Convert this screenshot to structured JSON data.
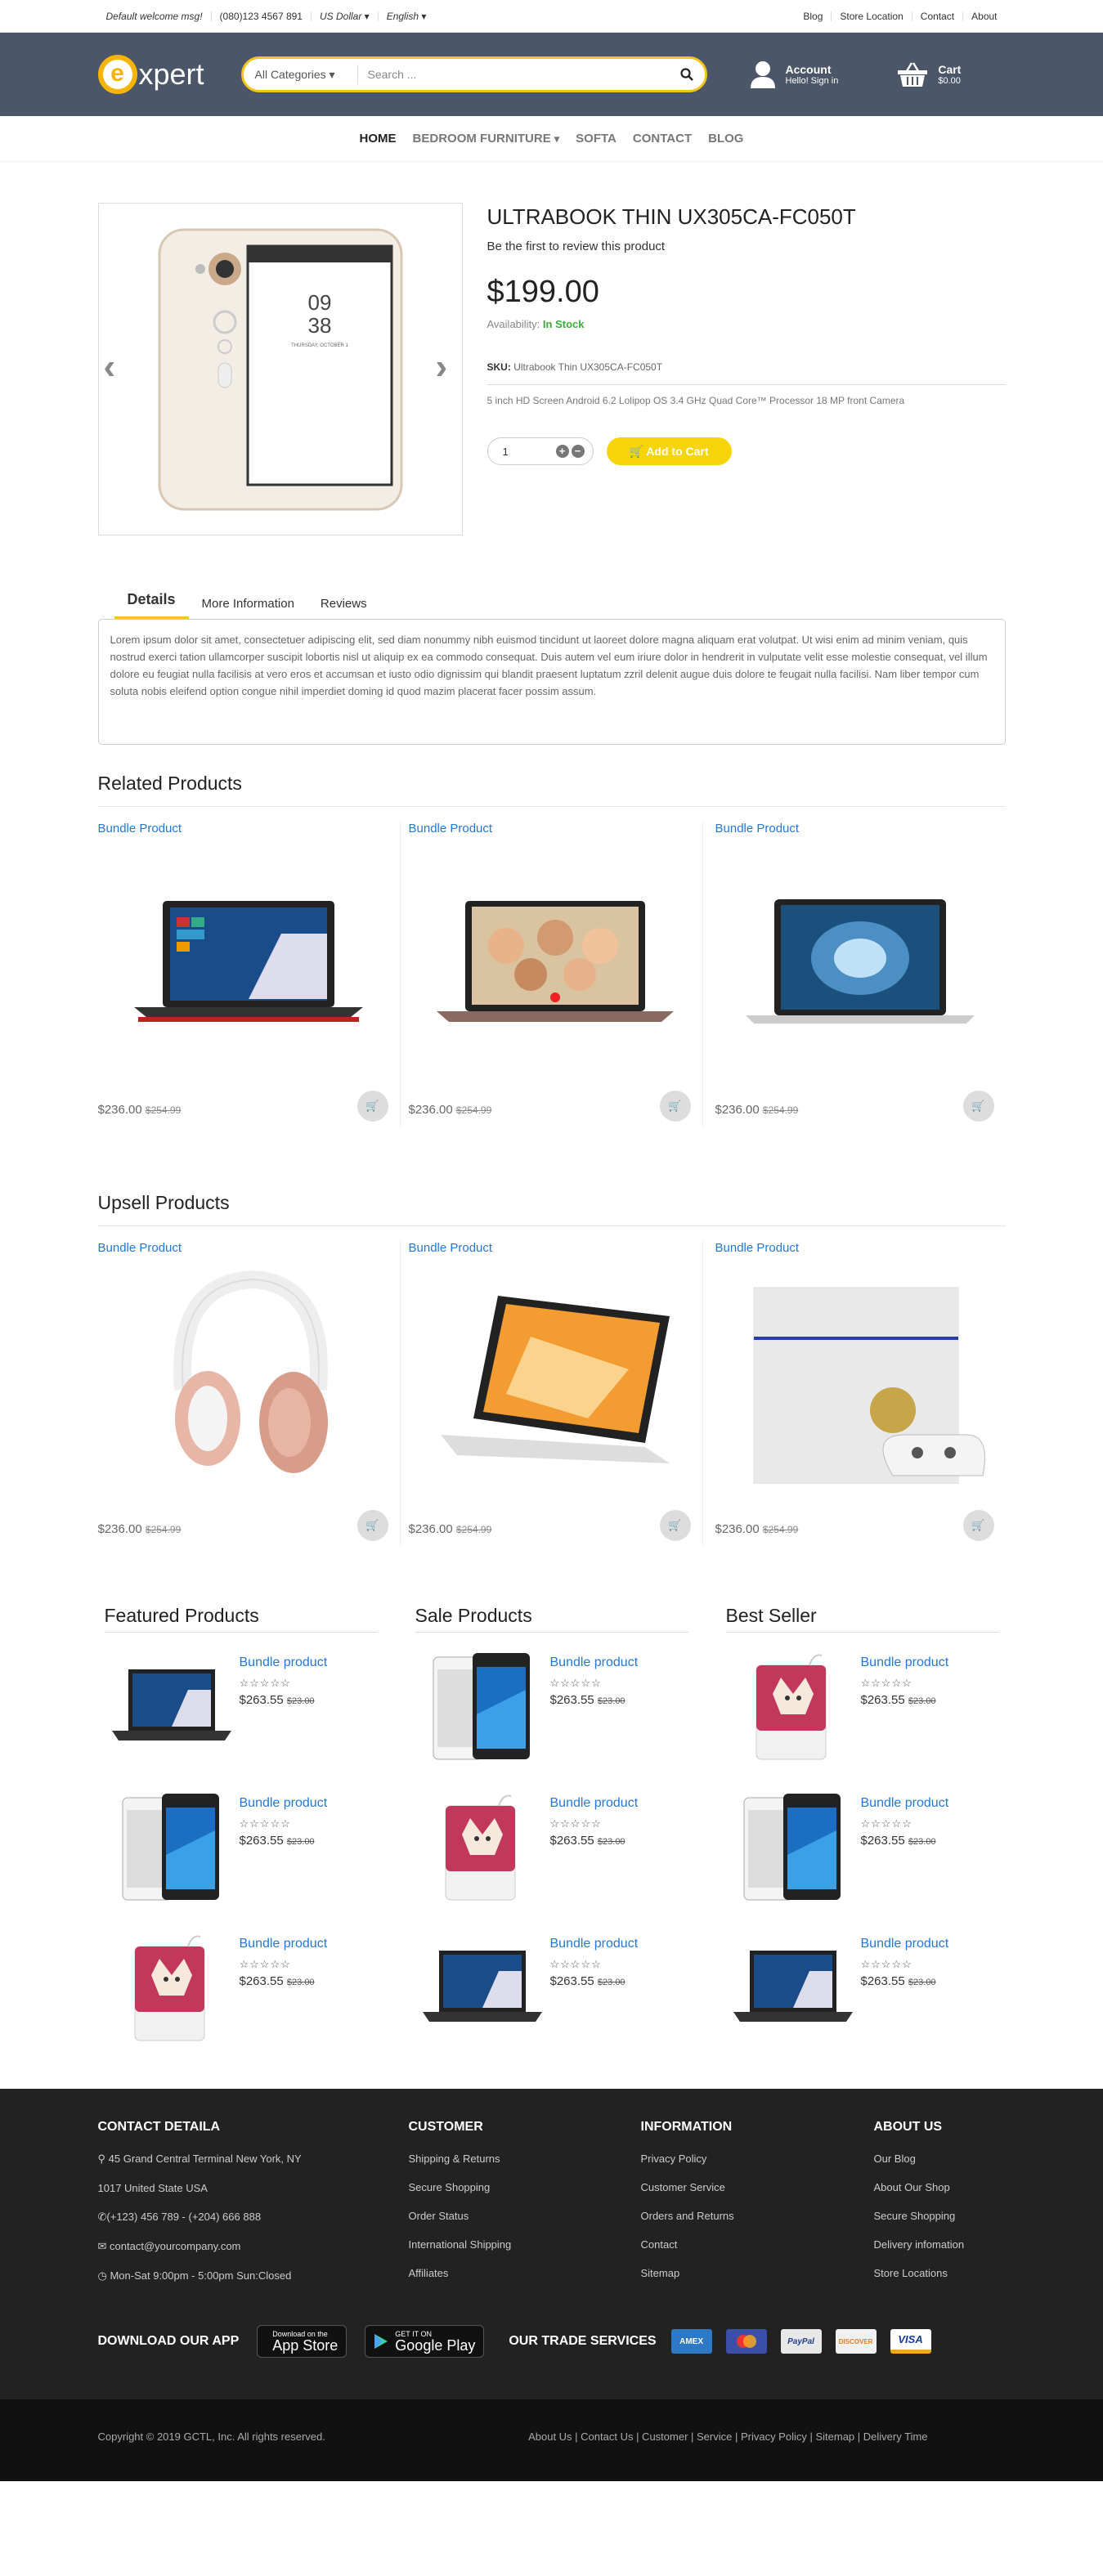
{
  "topbar": {
    "welcome": "Default welcome msg!",
    "phone": "(080)123 4567 891",
    "currency": "US Dollar",
    "language": "English",
    "links": [
      "Blog",
      "Store Location",
      "Contact",
      "About"
    ]
  },
  "header": {
    "logo_letter": "e",
    "logo_text": "xpert",
    "search_category": "All Categories",
    "search_placeholder": "Search ...",
    "account_title": "Account",
    "account_sub": "Hello! Sign in",
    "cart_title": "Cart",
    "cart_total": "$0.00"
  },
  "nav": [
    "HOME",
    "BEDROOM FURNITURE",
    "SOFTA",
    "CONTACT",
    "BLOG"
  ],
  "product": {
    "name": "ULTRABOOK THIN UX305CA-FC050T",
    "review_text": "Be the first to review this product",
    "price": "$199.00",
    "availability_label": "Availability:",
    "availability_value": "In Stock",
    "sku_label": "SKU:",
    "sku_value": "Ultrabook Thin UX305CA-FC050T",
    "short_desc": "5 inch HD Screen Android 6.2 Lolipop OS 3.4 GHz Quad Core™ Processor 18 MP front Camera",
    "qty": "1",
    "add_to_cart": "Add to Cart",
    "phone_time_h": "09",
    "phone_time_m": "38",
    "phone_date": "THURSDAY, OCTOBER 1"
  },
  "tabs": {
    "items": [
      "Details",
      "More Information",
      "Reviews"
    ],
    "details_text": "Lorem ipsum dolor sit amet, consectetuer adipiscing elit, sed diam nonummy nibh euismod tincidunt ut laoreet dolore magna aliquam erat volutpat. Ut wisi enim ad minim veniam, quis nostrud exerci tation ullamcorper suscipit lobortis nisl ut aliquip ex ea commodo consequat. Duis autem vel eum iriure dolor in hendrerit in vulputate velit esse molestie consequat, vel illum dolore eu feugiat nulla facilisis at vero eros et accumsan et iusto odio dignissim qui blandit praesent luptatum zzril delenit augue duis dolore te feugait nulla facilisi. Nam liber tempor cum soluta nobis eleifend option congue nihil imperdiet doming id quod mazim placerat facer possim assum."
  },
  "related": {
    "title": "Related Products",
    "items": [
      {
        "name": "Bundle Product",
        "price": "$236.00",
        "old_price": "$254.99",
        "image": "laptop-windows"
      },
      {
        "name": "Bundle Product",
        "price": "$236.00",
        "old_price": "$254.99",
        "image": "laptop-asus"
      },
      {
        "name": "Bundle Product",
        "price": "$236.00",
        "old_price": "$254.99",
        "image": "macbook"
      }
    ]
  },
  "upsell": {
    "title": "Upsell Products",
    "items": [
      {
        "name": "Bundle Product",
        "price": "$236.00",
        "old_price": "$254.99",
        "image": "headphones"
      },
      {
        "name": "Bundle Product",
        "price": "$236.00",
        "old_price": "$254.99",
        "image": "laptop-yoga"
      },
      {
        "name": "Bundle Product",
        "price": "$236.00",
        "old_price": "$254.99",
        "image": "ps4"
      }
    ]
  },
  "lists": [
    {
      "title": "Featured Products",
      "items": [
        {
          "name": "Bundle product",
          "price": "$263.55",
          "old_price": "$23.00",
          "image": "laptop"
        },
        {
          "name": "Bundle product",
          "price": "$263.55",
          "old_price": "$23.00",
          "image": "phones"
        },
        {
          "name": "Bundle product",
          "price": "$263.55",
          "old_price": "$23.00",
          "image": "powerbank"
        }
      ]
    },
    {
      "title": "Sale Products",
      "items": [
        {
          "name": "Bundle product",
          "price": "$263.55",
          "old_price": "$23.00",
          "image": "phones"
        },
        {
          "name": "Bundle product",
          "price": "$263.55",
          "old_price": "$23.00",
          "image": "powerbank"
        },
        {
          "name": "Bundle product",
          "price": "$263.55",
          "old_price": "$23.00",
          "image": "laptop"
        }
      ]
    },
    {
      "title": "Best Seller",
      "items": [
        {
          "name": "Bundle product",
          "price": "$263.55",
          "old_price": "$23.00",
          "image": "powerbank"
        },
        {
          "name": "Bundle product",
          "price": "$263.55",
          "old_price": "$23.00",
          "image": "phones"
        },
        {
          "name": "Bundle product",
          "price": "$263.55",
          "old_price": "$23.00",
          "image": "laptop"
        }
      ]
    }
  ],
  "stars": "☆☆☆☆☆",
  "footer": {
    "contact_title": "CONTACT DETAILA",
    "contact": [
      "45 Grand Central Terminal New York, NY",
      "1017 United State USA",
      "(+123) 456 789 - (+204) 666 888",
      "contact@yourcompany.com",
      "Mon-Sat 9:00pm - 5:00pm Sun:Closed"
    ],
    "customer_title": "CUSTOMER",
    "customer": [
      "Shipping & Returns",
      "Secure Shopping",
      "Order Status",
      "International Shipping",
      "Affiliates"
    ],
    "info_title": "INFORMATION",
    "info": [
      "Privacy Policy",
      "Customer Service",
      "Orders and Returns",
      "Contact",
      "Sitemap"
    ],
    "about_title": "ABOUT US",
    "about": [
      "Our Blog",
      "About Our Shop",
      "Secure Shopping",
      "Delivery infomation",
      "Store Locations"
    ],
    "app_title": "DOWNLOAD OUR APP",
    "appstore_small": "Download on the",
    "appstore_big": "App Store",
    "gplay_small": "GET IT ON",
    "gplay_big": "Google Play",
    "trade_title": "OUR TRADE SERVICES",
    "payments": [
      "AMEX",
      "",
      "PayPal",
      "DISCOVER",
      "VISA"
    ],
    "copyright": "Copyright © 2019 GCTL, Inc. All rights reserved.",
    "bottom_links": "About Us | Contact Us | Customer | Service | Privacy Policy | Sitemap | Delivery Time"
  },
  "colors": {
    "header_bg": "#4b5669",
    "accent": "#f5c518",
    "link": "#2478d6",
    "in_stock": "#3cab3b",
    "footer_bg": "#222222"
  }
}
